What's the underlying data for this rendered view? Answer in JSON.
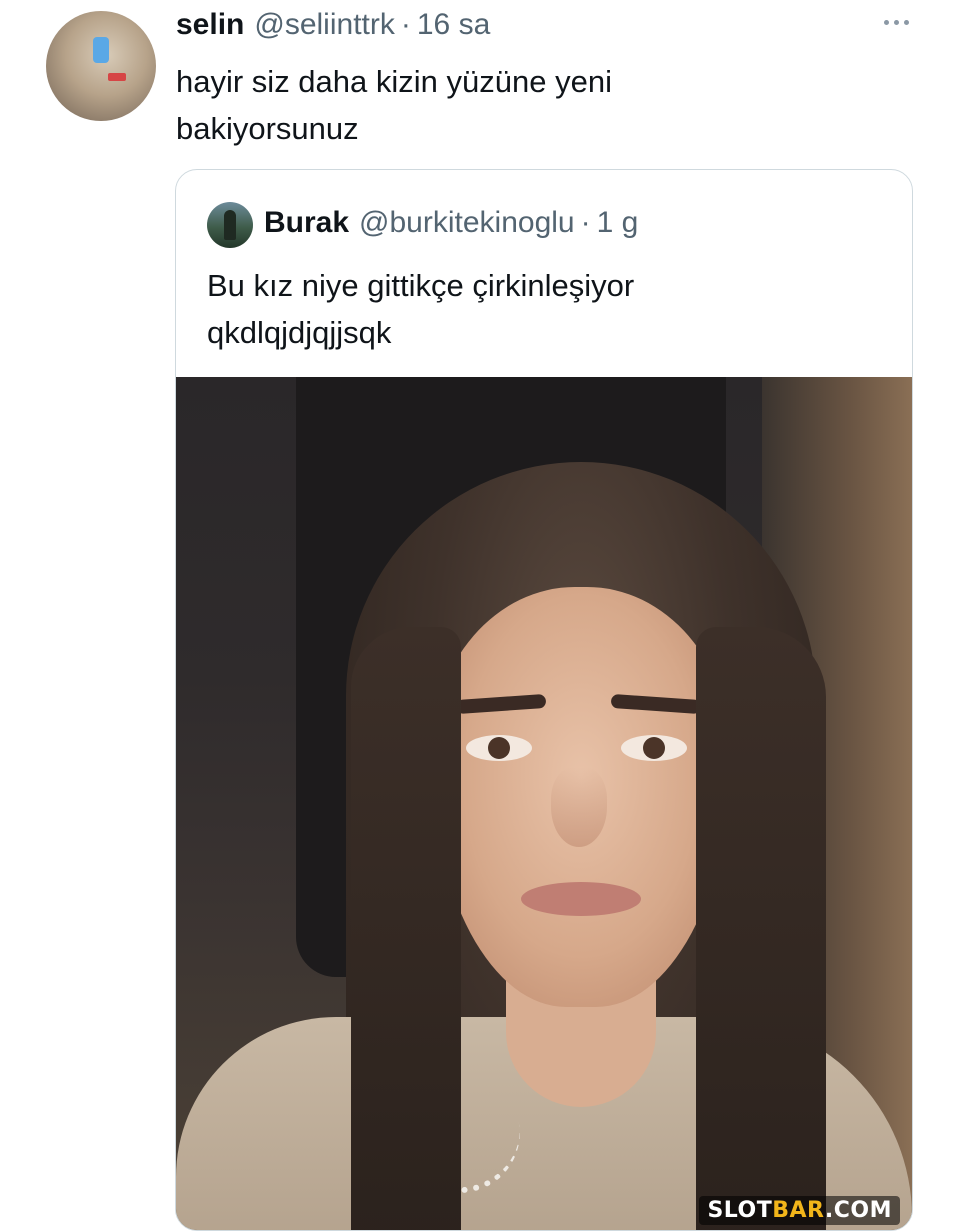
{
  "tweet": {
    "author_name": "selin",
    "author_handle": "@seliinttrk",
    "separator": "·",
    "time": "16 sa",
    "text": "hayir siz daha kizin yüzüne yeni bakiyorsunuz"
  },
  "quoted_tweet": {
    "author_name": "Burak",
    "author_handle": "@burkitekinoglu",
    "separator": "·",
    "time": "1 g",
    "text_line1": "Bu kız niye gittikçe çirkinleşiyor",
    "text_line2": "qkdlqjdjqjjsqk"
  },
  "media": {
    "watermark_part1": "SLOT",
    "watermark_part2": "BAR",
    "watermark_part3": ".COM"
  },
  "colors": {
    "text_primary": "#0f1419",
    "text_secondary": "#536471",
    "border": "#cfd9de",
    "watermark_accent": "#f2b51a"
  },
  "icons": {
    "more": "more-horizontal-icon"
  }
}
